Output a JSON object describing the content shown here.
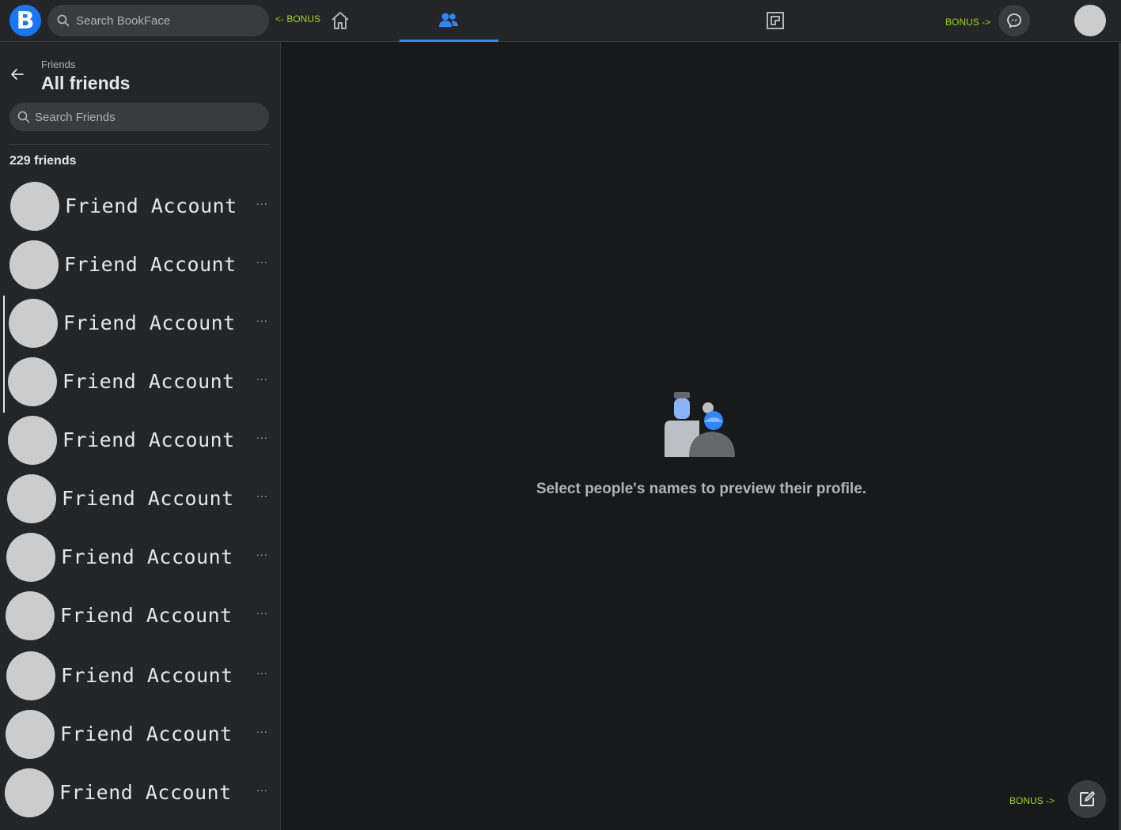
{
  "app": {
    "logo_letter": "B",
    "search_placeholder": "Search BookFace",
    "bonus_left": "<- BONUS",
    "bonus_right": "BONUS ->",
    "bonus_bottom": "BONUS ->",
    "accent_color": "#1877f2",
    "bonus_color": "#a6d40f"
  },
  "nav": {
    "icons": [
      "home-icon",
      "friends-icon",
      "groups-icon"
    ],
    "active": "friends-icon"
  },
  "sidebar": {
    "breadcrumb": "Friends",
    "title": "All friends",
    "search_placeholder": "Search Friends",
    "count": "229 friends",
    "friends": [
      {
        "name": "Friend Account",
        "more": "..."
      },
      {
        "name": "Friend Account",
        "more": "..."
      },
      {
        "name": "Friend Account",
        "more": "..."
      },
      {
        "name": "Friend Account",
        "more": "..."
      },
      {
        "name": "Friend Account",
        "more": "..."
      },
      {
        "name": "Friend Account",
        "more": "..."
      },
      {
        "name": "Friend Account",
        "more": "..."
      },
      {
        "name": "Friend Account",
        "more": "..."
      },
      {
        "name": "Friend Account",
        "more": "..."
      },
      {
        "name": "Friend Account",
        "more": "..."
      },
      {
        "name": "Friend Account",
        "more": "..."
      }
    ]
  },
  "main": {
    "empty_message": "Select people's names to preview their profile."
  }
}
